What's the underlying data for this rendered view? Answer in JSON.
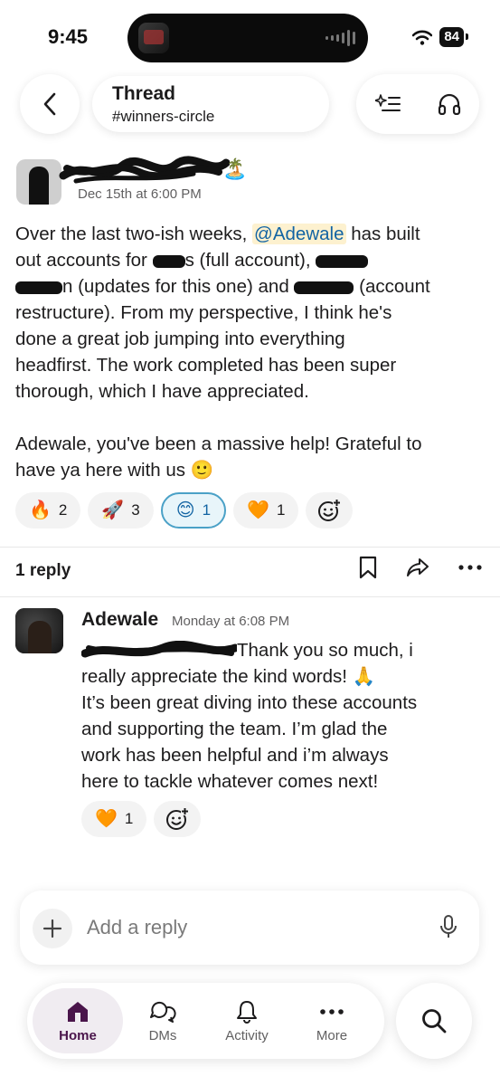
{
  "status_bar": {
    "time": "9:45",
    "battery": "84"
  },
  "header": {
    "title": "Thread",
    "channel": "#winners-circle",
    "icons": [
      "back-chevron-icon",
      "ai-summary-icon",
      "headphones-icon"
    ]
  },
  "parent_message": {
    "author_emoji": "🏝️",
    "timestamp": "Dec 15th at 6:00 PM",
    "body": {
      "line1_a": "Over the last two-ish weeks, ",
      "mention": "@Adewale",
      "line1_b": " has built",
      "line2_a": "out accounts for ",
      "line2_b": "s (full account), ",
      "line3_a": "n (updates for this one) and ",
      "line3_b": " (account",
      "line4": "restructure). From my perspective, I think he's",
      "line5": "done a great job jumping into everything",
      "line6": "headfirst. The work completed has been super",
      "line7": "thorough, which I have appreciated.",
      "para2_line1": "Adewale, you've been a massive help! Grateful to",
      "para2_line2": "have ya here with us 🙂"
    },
    "reactions": [
      {
        "emoji": "🔥",
        "count": "2",
        "selected": false
      },
      {
        "emoji": "🚀",
        "count": "3",
        "selected": false
      },
      {
        "emoji": "😊",
        "count": "1",
        "selected": true
      },
      {
        "emoji": "🧡",
        "count": "1",
        "selected": false
      }
    ]
  },
  "reply_bar": {
    "count_label": "1 reply"
  },
  "reply": {
    "author": "Adewale",
    "timestamp": "Monday at 6:08 PM",
    "body": {
      "line1": "Thank you so much, i",
      "line2": "really appreciate the kind words! 🙏",
      "line3": "It’s been great diving into these accounts",
      "line4": "and supporting the team. I’m glad the",
      "line5": "work has been helpful and i’m always",
      "line6": "here to tackle whatever comes next!"
    },
    "reactions": [
      {
        "emoji": "🧡",
        "count": "1"
      }
    ]
  },
  "composer": {
    "placeholder": "Add a reply"
  },
  "tabbar": {
    "tabs": [
      {
        "label": "Home",
        "active": true
      },
      {
        "label": "DMs",
        "active": false
      },
      {
        "label": "Activity",
        "active": false
      },
      {
        "label": "More",
        "active": false
      }
    ]
  },
  "colors": {
    "accent": "#4a154b",
    "link": "#1264a3",
    "mention_bg": "#fdf1cf",
    "selected_reaction_border": "#4aa1c7"
  }
}
